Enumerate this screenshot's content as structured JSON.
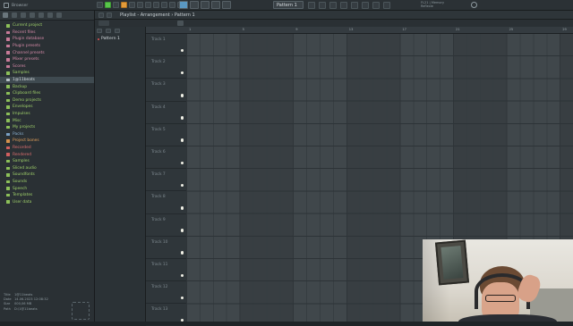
{
  "app": {
    "browser_title": "Browser",
    "pattern_selector": "Pattern 1",
    "playlist_title": "Playlist - Arrangement › Pattern 1",
    "cpu_text": "FL21 | Memory",
    "cpu_sub": "Reflexie"
  },
  "colors": {
    "accent_green": "#58c54a",
    "accent_blue": "#4d8cc8",
    "grid_bg": "#3a4145",
    "track_led": "#f0f0e6"
  },
  "browser": {
    "items": [
      {
        "label": "Current project",
        "color": "green"
      },
      {
        "label": "Recent files",
        "color": "pink"
      },
      {
        "label": "Plugin database",
        "color": "pink"
      },
      {
        "label": "Plugin presets",
        "color": "pink"
      },
      {
        "label": "Channel presets",
        "color": "pink"
      },
      {
        "label": "Mixer presets",
        "color": "pink"
      },
      {
        "label": "Scores",
        "color": "pink"
      },
      {
        "label": "Samples",
        "color": "green"
      },
      {
        "label": "1@11beats",
        "color": "white",
        "selected": true
      },
      {
        "label": "Backup",
        "color": "green"
      },
      {
        "label": "Clipboard files",
        "color": "green"
      },
      {
        "label": "Demo projects",
        "color": "green"
      },
      {
        "label": "Envelopes",
        "color": "green"
      },
      {
        "label": "Impulses",
        "color": "green"
      },
      {
        "label": "Misc",
        "color": "green"
      },
      {
        "label": "My projects",
        "color": "green"
      },
      {
        "label": "Packs",
        "color": "blue"
      },
      {
        "label": "Project bones",
        "color": "orange"
      },
      {
        "label": "Recorded",
        "color": "red"
      },
      {
        "label": "Rendered",
        "color": "red"
      },
      {
        "label": "Samples",
        "color": "green"
      },
      {
        "label": "Sliced audio",
        "color": "green"
      },
      {
        "label": "Soundfonts",
        "color": "green"
      },
      {
        "label": "Sounds",
        "color": "green"
      },
      {
        "label": "Speech",
        "color": "green"
      },
      {
        "label": "Templates",
        "color": "green"
      },
      {
        "label": "User data",
        "color": "green"
      }
    ],
    "file_info": {
      "title_key": "Title",
      "title_val": "1@11beats",
      "date_key": "Date",
      "date_val": "14.06.2023 12:08:32",
      "size_key": "Size",
      "size_val": "000,06 MB",
      "path_key": "Path",
      "path_val": "D:\\1@11beats"
    }
  },
  "picker": {
    "items": [
      "Pattern 1"
    ]
  },
  "tracks": [
    "Track 1",
    "Track 2",
    "Track 3",
    "Track 4",
    "Track 5",
    "Track 6",
    "Track 7",
    "Track 8",
    "Track 9",
    "Track 10",
    "Track 11",
    "Track 12",
    "Track 13"
  ],
  "ruler": [
    "1",
    "",
    "",
    "",
    "5",
    "",
    "",
    "",
    "9",
    "",
    "",
    "",
    "13",
    "",
    "",
    "",
    "17",
    "",
    "",
    "",
    "21",
    "",
    "",
    "",
    "25",
    "",
    "",
    "",
    "29",
    ""
  ]
}
